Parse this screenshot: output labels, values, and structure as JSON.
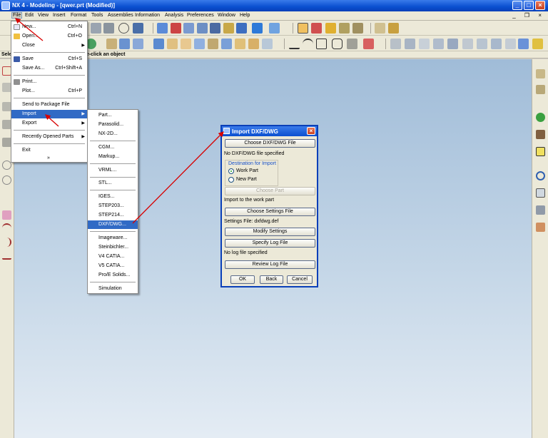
{
  "window": {
    "title": "NX 4 - Modeling - [qwer.prt (Modified)]",
    "minimize": "_",
    "maximize": "□",
    "close": "×"
  },
  "menubar": {
    "items": [
      "File",
      "Edit",
      "View",
      "Insert",
      "Format",
      "Tools",
      "Assemblies",
      "Information",
      "Analysis",
      "Preferences",
      "Window",
      "Help"
    ],
    "doc_controls": "_ ❐ ×"
  },
  "cue": {
    "left_fragment": "Sele",
    "message": "le-click an object"
  },
  "file_menu": {
    "items": [
      {
        "label": "New...",
        "accel": "Ctrl+N"
      },
      {
        "label": "Open...",
        "accel": "Ctrl+O"
      },
      {
        "label": "Close",
        "accel": "",
        "submenu": true
      },
      {
        "label": "Save",
        "accel": "Ctrl+S"
      },
      {
        "label": "Save As...",
        "accel": "Ctrl+Shift+A"
      },
      {
        "label": "Print...",
        "accel": ""
      },
      {
        "label": "Plot...",
        "accel": "Ctrl+P"
      },
      {
        "label": "Send to Package File",
        "accel": ""
      },
      {
        "label": "Import",
        "accel": "",
        "submenu": true
      },
      {
        "label": "Export",
        "accel": "",
        "submenu": true
      },
      {
        "label": "Recently Opened Parts",
        "accel": "",
        "submenu": true
      },
      {
        "label": "Exit",
        "accel": ""
      },
      {
        "label": "»",
        "accel": ""
      }
    ]
  },
  "import_menu": {
    "items": [
      "Part...",
      "Parasolid...",
      "NX-2D...",
      "CGM...",
      "Markup...",
      "VRML...",
      "STL...",
      "IGES...",
      "STEP203...",
      "STEP214...",
      "DXF/DWG...",
      "Imageware...",
      "Steinbichler...",
      "V4 CATIA...",
      "V5 CATIA...",
      "Pro/E Solids...",
      "Simulation"
    ]
  },
  "dialog": {
    "title": "Import DXF/DWG",
    "close": "×",
    "choose_file_button": "Choose DXF/DWG File",
    "file_status": "No DXF/DWG file specified",
    "destination_label": "Destination for Import",
    "radio_work_part": "Work Part",
    "radio_new_part": "New Part",
    "selected_destination": "Work Part",
    "choose_part_button": "Choose Part",
    "import_status": "Import to the work part",
    "choose_settings_button": "Choose Settings File",
    "settings_status": "Settings File: dxfdwg.def",
    "modify_settings_button": "Modify Settings",
    "specify_log_button": "Specify Log File",
    "log_status": "No log file specified",
    "review_log_button": "Review Log File",
    "ok_button": "OK",
    "back_button": "Back",
    "cancel_button": "Cancel"
  },
  "colors": {
    "titlebar": "#0a4fd0",
    "highlight": "#316ac5",
    "annotation_arrow": "#d80000",
    "group_label": "#1750c9"
  }
}
